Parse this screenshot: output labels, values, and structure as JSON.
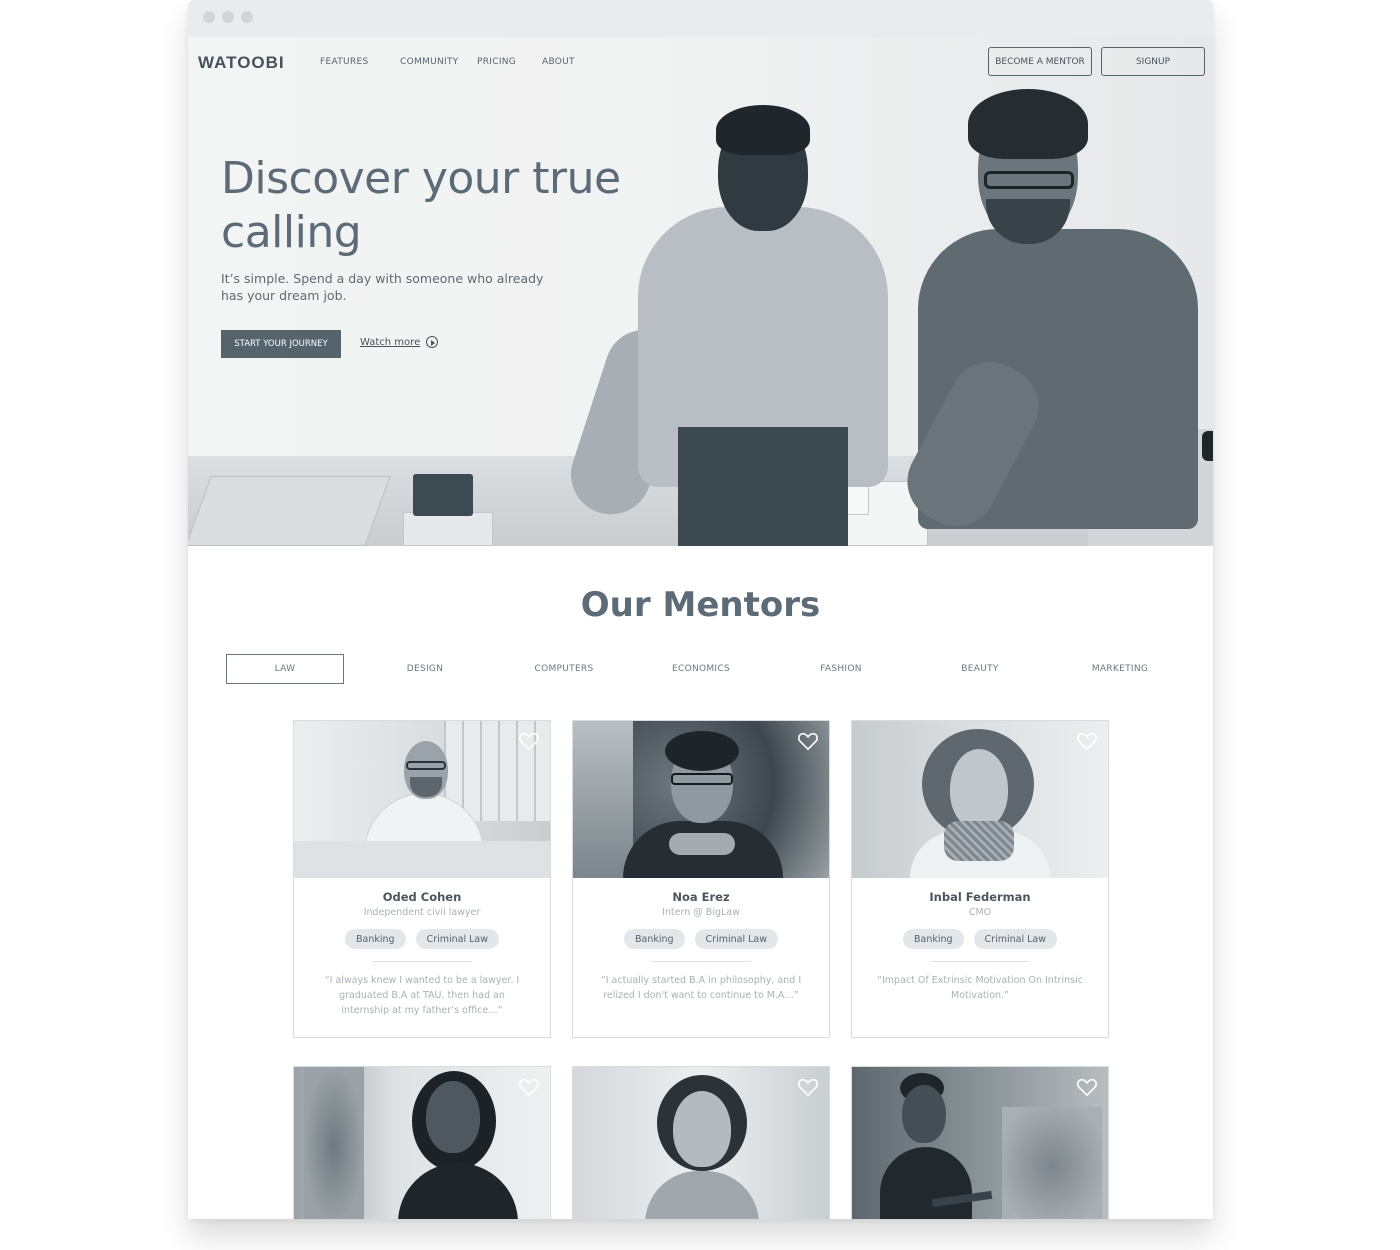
{
  "nav": {
    "logo": "WATOOBI",
    "links": [
      "FEATURES",
      "COMMUNITY",
      "PRICING",
      "ABOUT"
    ],
    "become_mentor": "BECOME A MENTOR",
    "signup": "SIGNUP"
  },
  "hero": {
    "title": "Discover your true calling",
    "subtitle": "It’s simple. Spend a day with someone who already has your dream job.",
    "cta": "START YOUR JOURNEY",
    "watch_more": "Watch more"
  },
  "mentors": {
    "title": "Our Mentors",
    "tabs": [
      "LAW",
      "DESIGN",
      "COMPUTERS",
      "ECONOMICS",
      "FASHION",
      "BEAUTY",
      "MARKETING"
    ],
    "active_tab": "LAW",
    "cards": [
      {
        "name": "Oded Cohen",
        "role": "Independent civil lawyer",
        "tags": [
          "Banking",
          "Criminal Law"
        ],
        "quote": "“I always knew I wanted to be a lawyer. I graduated B.A at TAU, then had an internship at my father’s office…”"
      },
      {
        "name": "Noa Erez",
        "role": "Intern @ BigLaw",
        "tags": [
          "Banking",
          "Criminal Law"
        ],
        "quote": "“I actually started B.A in philosophy, and I relized I don't want to continue to M.A…”"
      },
      {
        "name": "Inbal Federman",
        "role": "CMO",
        "tags": [
          "Banking",
          "Criminal Law"
        ],
        "quote": "“Impact Of Extrinsic Motivation On Intrinsic Motivation.”"
      }
    ]
  },
  "colors": {
    "primary": "#55636d",
    "text": "#5b6b77",
    "muted": "#a9b1b7",
    "tag_bg": "#e4e7e9"
  }
}
